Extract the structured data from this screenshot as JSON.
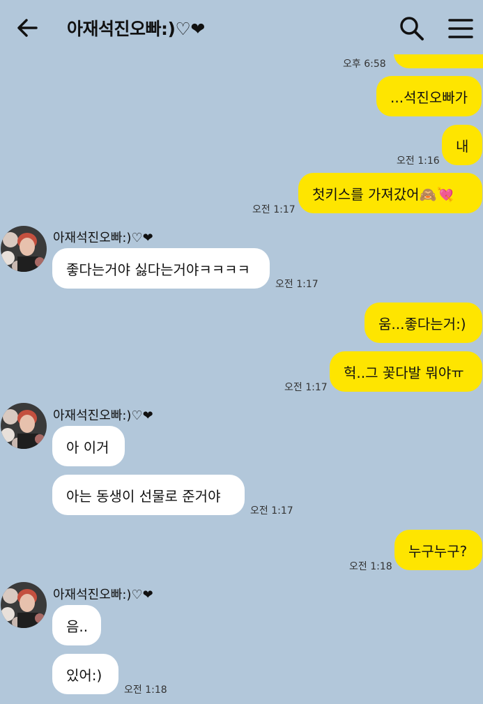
{
  "header": {
    "title": "아재석진오빠:)♡❤",
    "back_icon": "back-arrow-icon",
    "search_icon": "search-icon",
    "menu_icon": "menu-icon"
  },
  "colors": {
    "background": "#b2c7da",
    "my_bubble": "#fee500",
    "their_bubble": "#ffffff"
  },
  "messages": [
    {
      "from": "me",
      "time": "오후 6:58"
    },
    {
      "from": "me",
      "text": "...석진오빠가"
    },
    {
      "from": "me",
      "text": "내",
      "time": "오전 1:16"
    },
    {
      "from": "me",
      "text": "첫키스를 가져갔어🙈💘",
      "time": "오전 1:17"
    },
    {
      "from": "them",
      "sender": "아재석진오빠:)♡❤",
      "text": "좋다는거야 싫다는거야ㅋㅋㅋㅋ",
      "time": "오전 1:17"
    },
    {
      "from": "me",
      "text": "움...좋다는거:)"
    },
    {
      "from": "me",
      "text": "헉..그 꽃다발 뭐야ㅠ",
      "time": "오전 1:17"
    },
    {
      "from": "them",
      "sender": "아재석진오빠:)♡❤",
      "text": "아 이거"
    },
    {
      "from": "them",
      "text": "아는 동생이 선물로 준거야",
      "time": "오전 1:17"
    },
    {
      "from": "me",
      "text": "누구누구?",
      "time": "오전 1:18"
    },
    {
      "from": "them",
      "sender": "아재석진오빠:)♡❤",
      "text": "음.."
    },
    {
      "from": "them",
      "text": "있어:)",
      "time": "오전 1:18"
    }
  ]
}
